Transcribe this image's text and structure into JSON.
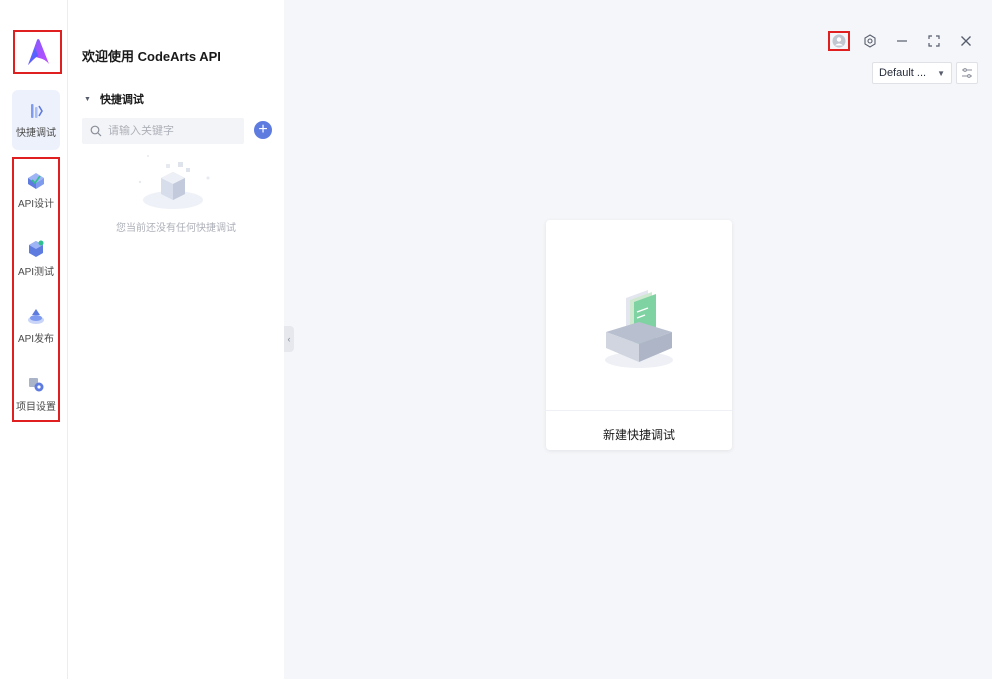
{
  "app": {
    "welcome": "欢迎使用 CodeArts API"
  },
  "rail": {
    "items": [
      {
        "label": "快捷调试",
        "icon": "quick-debug-icon",
        "active": true
      },
      {
        "label": "API设计",
        "icon": "api-design-icon"
      },
      {
        "label": "API测试",
        "icon": "api-test-icon"
      },
      {
        "label": "API发布",
        "icon": "api-publish-icon"
      },
      {
        "label": "项目设置",
        "icon": "project-settings-icon"
      }
    ]
  },
  "panel": {
    "section_title": "快捷调试",
    "search_placeholder": "请输入关键字",
    "empty_text": "您当前还没有任何快捷调试"
  },
  "header": {
    "environment": "Default ...",
    "icons": [
      "user-icon",
      "settings-icon",
      "minimize-icon",
      "maximize-icon",
      "close-icon"
    ]
  },
  "main": {
    "card_label": "新建快捷调试"
  },
  "colors": {
    "accent": "#5e7ce0",
    "highlight_box": "#e02020",
    "main_bg": "#f5f6f9"
  }
}
